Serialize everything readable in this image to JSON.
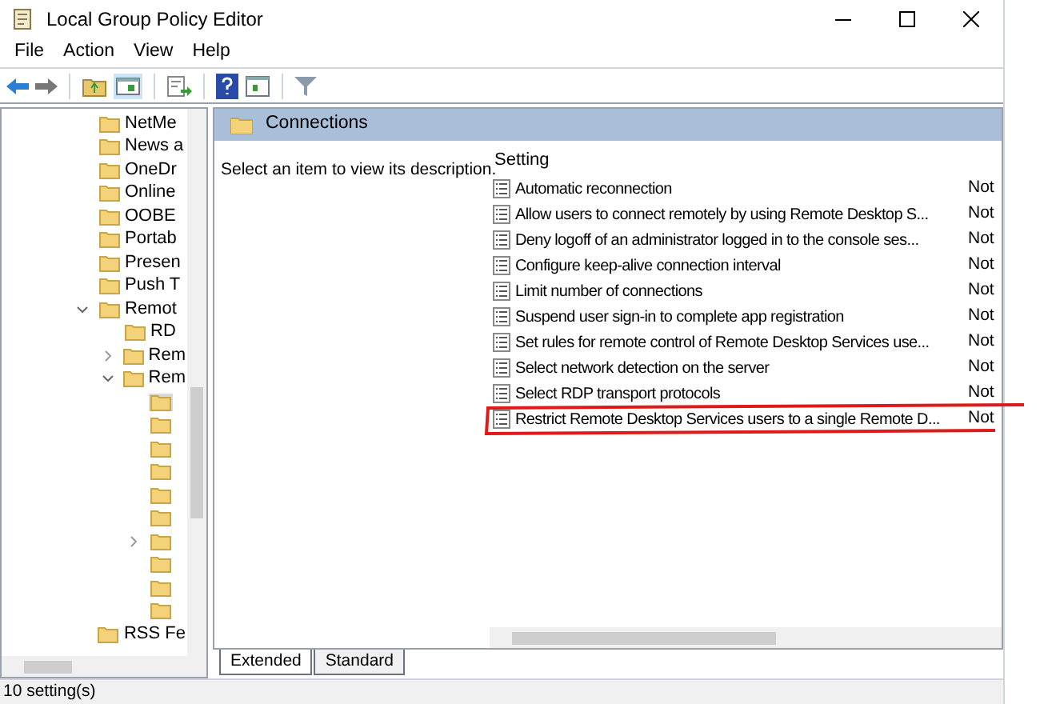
{
  "window": {
    "title": "Local Group Policy Editor"
  },
  "menu": [
    "File",
    "Action",
    "View",
    "Help"
  ],
  "tree": [
    {
      "label": "NetMe",
      "selected": false
    },
    {
      "label": "News a",
      "selected": false
    },
    {
      "label": "OneDr",
      "selected": false
    },
    {
      "label": "Online",
      "selected": false
    },
    {
      "label": "OOBE",
      "selected": false
    },
    {
      "label": "Portab",
      "selected": false
    },
    {
      "label": "Presen",
      "selected": false
    },
    {
      "label": "Push T",
      "selected": false
    },
    {
      "label": "Remot",
      "selected": false,
      "expanded": true,
      "children": [
        {
          "label": "RD",
          "selected": false
        },
        {
          "label": "Rem",
          "selected": false,
          "expanded": false
        },
        {
          "label": "Rem",
          "selected": false,
          "expanded": true,
          "children": [
            {
              "selected": true
            },
            {
              "selected": false
            },
            {
              "selected": false
            },
            {
              "selected": false
            },
            {
              "selected": false
            },
            {
              "selected": false
            },
            {
              "selected": false,
              "expanded": false
            },
            {
              "selected": false
            },
            {
              "selected": false
            },
            {
              "selected": false
            }
          ]
        }
      ]
    },
    {
      "label": "RSS Fe",
      "selected": false
    }
  ],
  "details": {
    "header": "Connections",
    "description": "Select an item to view its description.",
    "columns": [
      "Setting"
    ],
    "rows": [
      {
        "setting": "Automatic reconnection",
        "state": "Not"
      },
      {
        "setting": "Allow users to connect remotely by using Remote Desktop S...",
        "state": "Not"
      },
      {
        "setting": "Deny logoff of an administrator logged in to the console ses...",
        "state": "Not"
      },
      {
        "setting": "Configure keep-alive connection interval",
        "state": "Not"
      },
      {
        "setting": "Limit number of connections",
        "state": "Not"
      },
      {
        "setting": "Suspend user sign-in to complete app registration",
        "state": "Not"
      },
      {
        "setting": "Set rules for remote control of Remote Desktop Services use...",
        "state": "Not"
      },
      {
        "setting": "Select network detection on the server",
        "state": "Not"
      },
      {
        "setting": "Select RDP transport protocols",
        "state": "Not"
      },
      {
        "setting": "Restrict Remote Desktop Services users to a single Remote D...",
        "state": "Not"
      }
    ]
  },
  "tabs": [
    {
      "label": "Extended",
      "selected": true
    },
    {
      "label": "Standard",
      "selected": false
    }
  ],
  "status_bar": "10 setting(s)"
}
